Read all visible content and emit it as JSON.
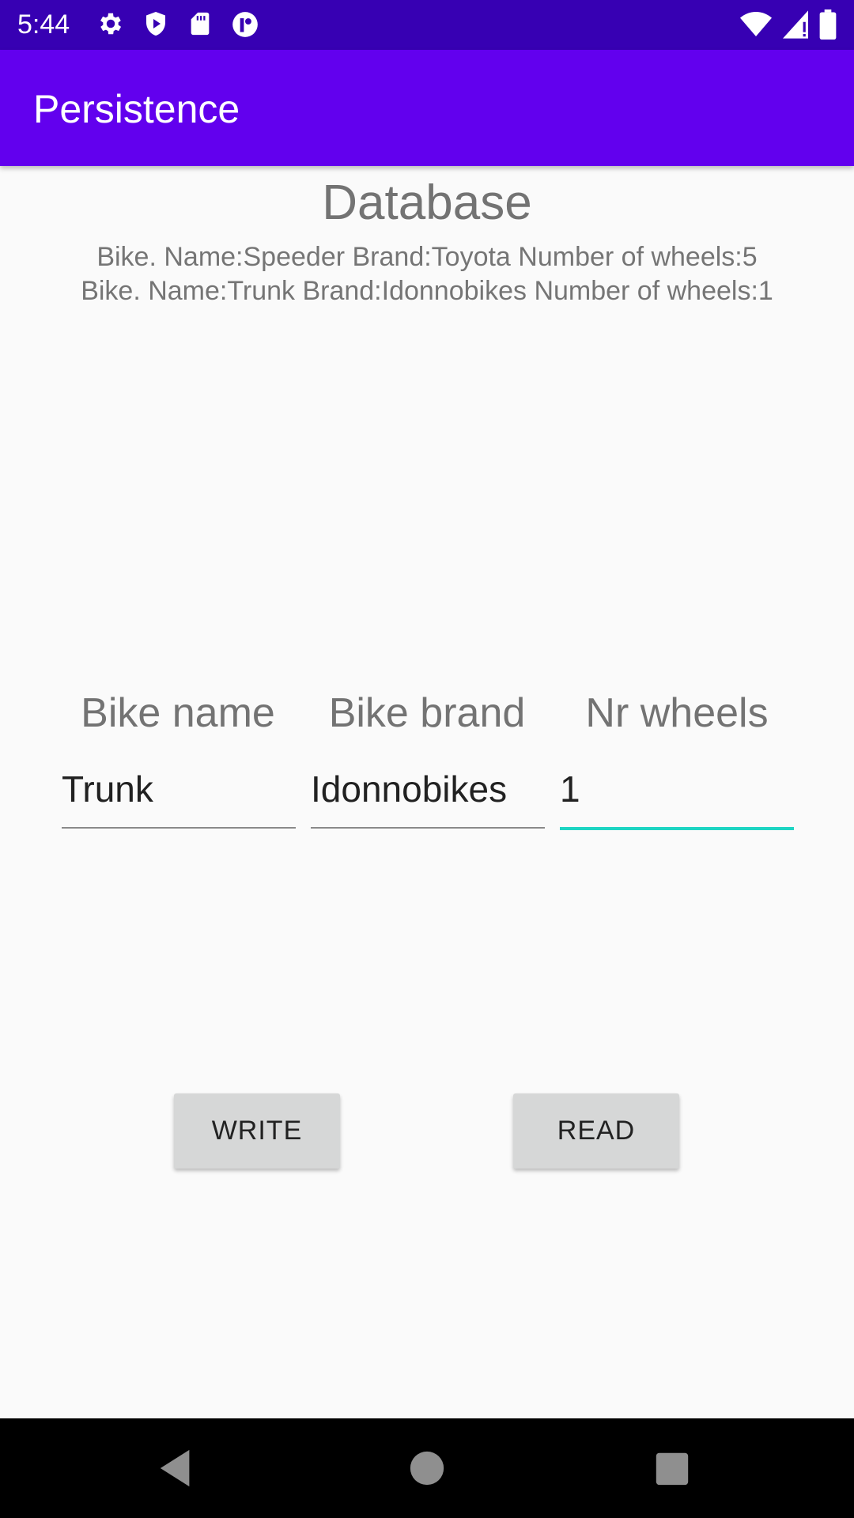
{
  "status_bar": {
    "time": "5:44",
    "left_icons": [
      "gear-icon",
      "play-shield-icon",
      "sd-card-icon",
      "app-notification-icon"
    ],
    "right_icons": [
      "wifi-icon",
      "cell-signal-icon",
      "battery-icon"
    ]
  },
  "app_bar": {
    "title": "Persistence",
    "color": "#6200ee"
  },
  "database": {
    "title": "Database",
    "rows": [
      "Bike. Name:Speeder Brand:Toyota Number of wheels:5",
      "Bike. Name:Trunk Brand:Idonnobikes Number of wheels:1"
    ]
  },
  "form": {
    "labels": {
      "name": "Bike name",
      "brand": "Bike brand",
      "wheels": "Nr wheels"
    },
    "values": {
      "name": "Trunk",
      "brand": "Idonnobikes",
      "wheels": "1"
    },
    "focused_field": "wheels",
    "focus_color": "#1ed5c3"
  },
  "buttons": {
    "write": "WRITE",
    "read": "READ"
  },
  "nav_bar": {
    "icons": [
      "back-icon",
      "home-icon",
      "recents-icon"
    ]
  }
}
